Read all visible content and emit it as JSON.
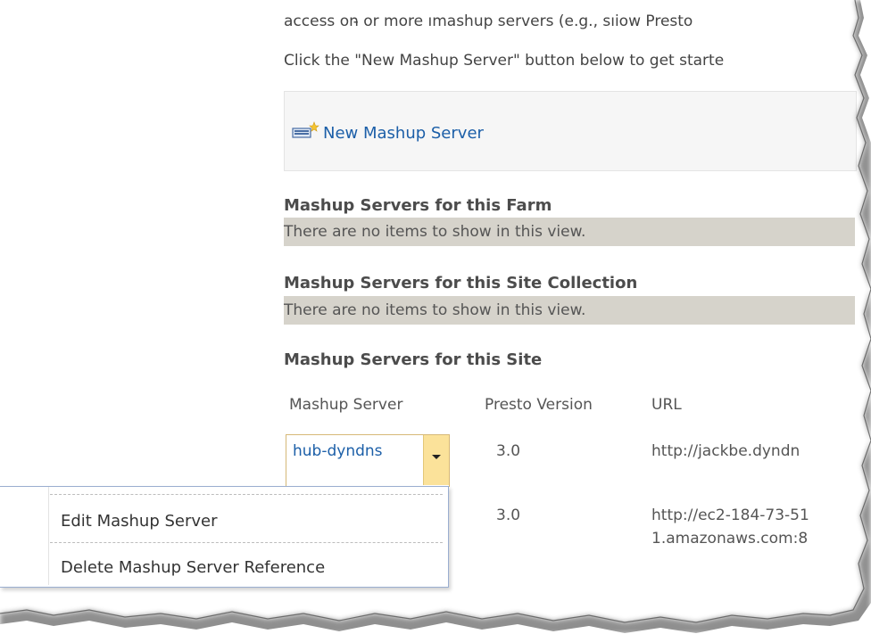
{
  "intro": {
    "line1": "access on̵ or more ımashup servers (e.g., sıiow Presto",
    "line2": "Click the \"New Mashup Server\" button below to get starte"
  },
  "toolbar": {
    "new_server_label": "New Mashup Server",
    "new_server_icon": "new-item-icon"
  },
  "sections": {
    "farm": {
      "heading": "Mashup Servers for this Farm",
      "empty": "There are no items to show in this view."
    },
    "site_collection": {
      "heading": "Mashup Servers for this Site Collection",
      "empty": "There are no items to show in this view."
    },
    "site": {
      "heading": "Mashup Servers for this Site"
    }
  },
  "table": {
    "columns": [
      "Mashup Server",
      "Presto Version",
      "URL"
    ],
    "rows": [
      {
        "server": "hub-dyndns",
        "version": "3.0",
        "url": "http://jackbe.dyndn"
      },
      {
        "server": "",
        "version": "3.0",
        "url_line1": "http://ec2-184-73-51",
        "url_line2": "1.amazonaws.com:8"
      }
    ]
  },
  "context_menu": {
    "items": [
      "Edit Mashup Server",
      "Delete Mashup Server Reference"
    ]
  },
  "colors": {
    "link": "#1c5fa8",
    "empty_bar": "#d6d3cb",
    "dropdown_highlight": "#fbe29a",
    "menu_border": "#9aaed0"
  }
}
